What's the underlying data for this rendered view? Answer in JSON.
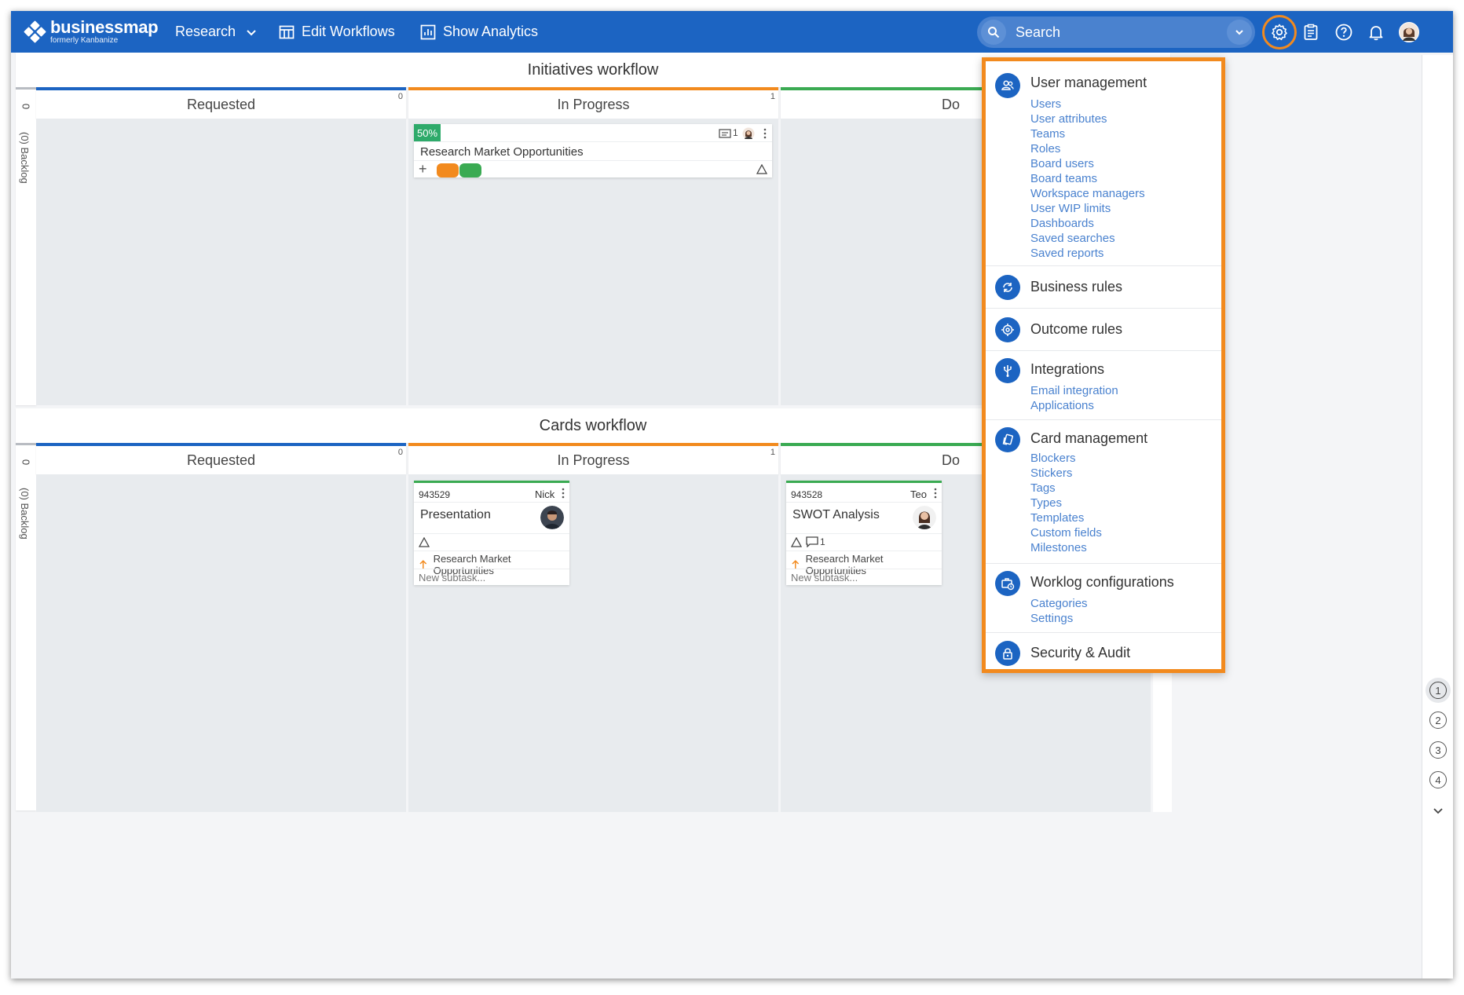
{
  "topbar": {
    "logo_name": "businessmap",
    "logo_sub": "formerly Kanbanize",
    "nav": [
      {
        "label": "Research"
      },
      {
        "label": "Edit Workflows"
      },
      {
        "label": "Show Analytics"
      }
    ],
    "search_placeholder": "Search"
  },
  "board": {
    "workflows": [
      {
        "title": "Initiatives workflow",
        "backlog_count": "0",
        "backlog_label": "(0) Backlog",
        "columns": [
          {
            "name": "Requested",
            "count": "0",
            "color": "#1c64c2"
          },
          {
            "name": "In Progress",
            "count": "1",
            "color": "#f28a1e"
          },
          {
            "name": "Do",
            "color": "#3aaa52"
          }
        ]
      },
      {
        "title": "Cards workflow",
        "backlog_count": "0",
        "backlog_label": "(0) Backlog",
        "columns": [
          {
            "name": "Requested",
            "count": "0",
            "color": "#1c64c2"
          },
          {
            "name": "In Progress",
            "count": "1",
            "color": "#f28a1e"
          },
          {
            "name": "Do",
            "color": "#3aaa52"
          }
        ]
      }
    ],
    "initiative_card": {
      "progress": "50%",
      "comment_count": "1",
      "title": "Research Market Opportunities",
      "chip_colors": [
        "#f28a1e",
        "#3aaa52"
      ]
    },
    "cards": [
      {
        "id": "943529",
        "owner": "Nick",
        "title": "Presentation",
        "parent": "Research Market Opportunities",
        "subtask_placeholder": "New subtask..."
      },
      {
        "id": "943528",
        "owner": "Teo",
        "title": "SWOT Analysis",
        "comment_count": "1",
        "parent": "Research Market Opportunities",
        "subtask_placeholder": "New subtask..."
      }
    ]
  },
  "side_strip": {
    "levels": [
      "1",
      "2",
      "3",
      "4"
    ]
  },
  "settings_menu": {
    "sections": [
      {
        "title": "User management",
        "icon": "users-icon",
        "items": [
          "Users",
          "User attributes",
          "Teams",
          "Roles",
          "Board users",
          "Board teams",
          "Workspace managers",
          "User WIP limits",
          "Dashboards",
          "Saved searches",
          "Saved reports"
        ]
      },
      {
        "title": "Business rules",
        "icon": "refresh-icon",
        "items": []
      },
      {
        "title": "Outcome rules",
        "icon": "target-icon",
        "items": []
      },
      {
        "title": "Integrations",
        "icon": "usb-icon",
        "items": [
          "Email integration",
          "Applications"
        ]
      },
      {
        "title": "Card management",
        "icon": "cards-icon",
        "items": [
          "Blockers",
          "Stickers",
          "Tags",
          "Types",
          "Templates",
          "Custom fields",
          "Milestones"
        ]
      },
      {
        "title": "Worklog configurations",
        "icon": "worklog-icon",
        "items": [
          "Categories",
          "Settings"
        ]
      },
      {
        "title": "Security & Audit",
        "icon": "lock-icon",
        "items": []
      }
    ]
  },
  "colors": {
    "brand": "#1c64c2",
    "highlight": "#f28a1e",
    "done": "#3aaa52"
  }
}
